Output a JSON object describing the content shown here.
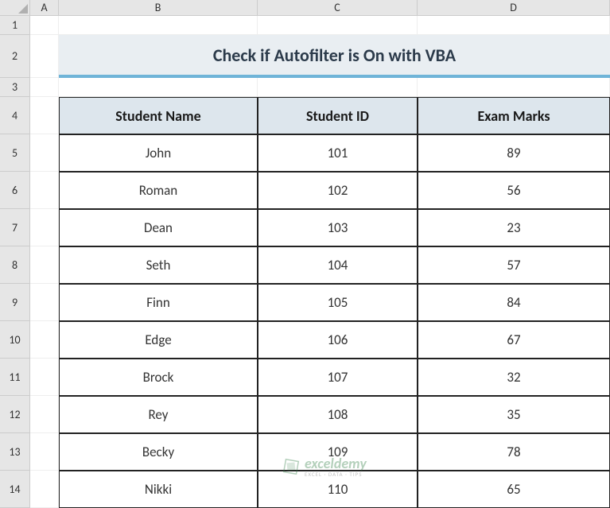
{
  "columns": [
    "A",
    "B",
    "C",
    "D"
  ],
  "rows": [
    "1",
    "2",
    "3",
    "4",
    "5",
    "6",
    "7",
    "8",
    "9",
    "10",
    "11",
    "12",
    "13",
    "14"
  ],
  "title": "Check if Autofilter is On with VBA",
  "headers": {
    "b": "Student Name",
    "c": "Student ID",
    "d": "Exam Marks"
  },
  "chart_data": {
    "type": "table",
    "columns": [
      "Student Name",
      "Student ID",
      "Exam Marks"
    ],
    "rows": [
      {
        "name": "John",
        "id": "101",
        "marks": "89"
      },
      {
        "name": "Roman",
        "id": "102",
        "marks": "56"
      },
      {
        "name": "Dean",
        "id": "103",
        "marks": "23"
      },
      {
        "name": "Seth",
        "id": "104",
        "marks": "57"
      },
      {
        "name": "Finn",
        "id": "105",
        "marks": "84"
      },
      {
        "name": "Edge",
        "id": "106",
        "marks": "67"
      },
      {
        "name": "Brock",
        "id": "107",
        "marks": "32"
      },
      {
        "name": "Rey",
        "id": "108",
        "marks": "35"
      },
      {
        "name": "Becky",
        "id": "109",
        "marks": "78"
      },
      {
        "name": "Nikki",
        "id": "110",
        "marks": "65"
      }
    ]
  },
  "watermark": {
    "brand": "exceldemy",
    "tagline": "EXCEL · DATA · TIPS"
  }
}
